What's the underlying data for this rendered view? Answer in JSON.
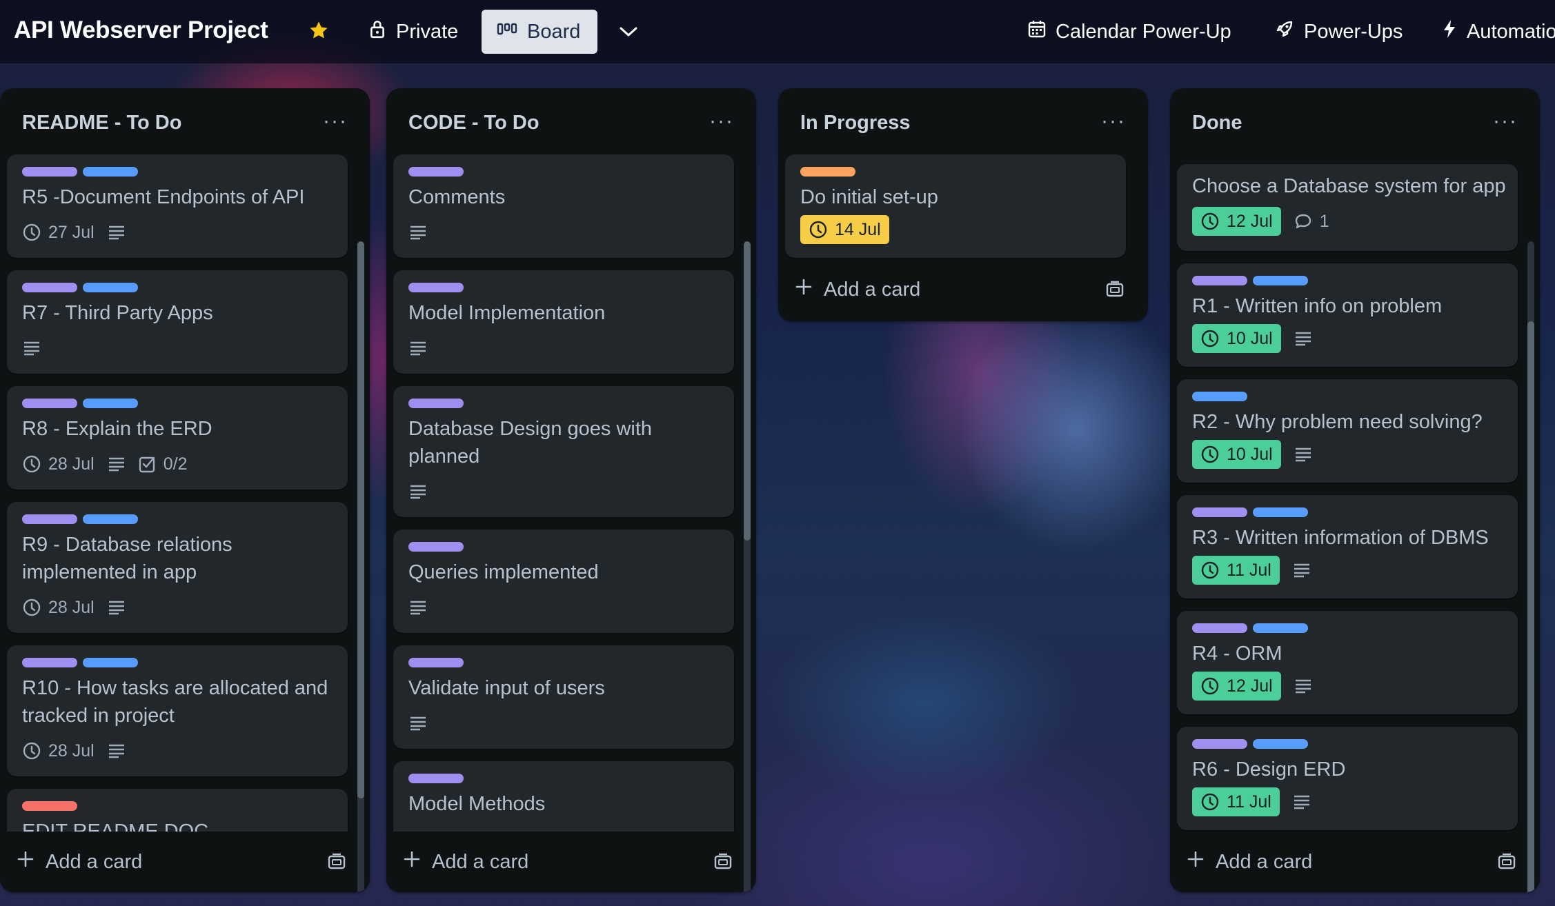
{
  "header": {
    "title": "API Webserver Project",
    "private_label": "Private",
    "board_label": "Board",
    "calendar_label": "Calendar Power-Up",
    "powerups_label": "Power-Ups",
    "automation_label": "Automation",
    "star_color": "#f5c518"
  },
  "common": {
    "add_card": "Add a card",
    "list_menu": "···"
  },
  "lists": [
    {
      "title": "README - To Do",
      "cards": [
        {
          "labels": [
            "purple",
            "blue"
          ],
          "title": "R5 -Document Endpoints of API",
          "due": "27 Jul",
          "description": true
        },
        {
          "labels": [
            "purple",
            "blue"
          ],
          "title": "R7 - Third Party Apps",
          "description": true
        },
        {
          "labels": [
            "purple",
            "blue"
          ],
          "title": "R8 - Explain the ERD",
          "due": "28 Jul",
          "description": true,
          "checklist": "0/2"
        },
        {
          "labels": [
            "purple",
            "blue"
          ],
          "title": "R9 - Database relations implemented in app",
          "due": "28 Jul",
          "description": true
        },
        {
          "labels": [
            "purple",
            "blue"
          ],
          "title": "R10 - How tasks are allocated and tracked in project",
          "due": "28 Jul",
          "description": true
        },
        {
          "labels": [
            "red"
          ],
          "title": "EDIT README DOC"
        }
      ]
    },
    {
      "title": "CODE - To Do",
      "cards": [
        {
          "labels": [
            "purple"
          ],
          "title": "Comments",
          "description": true
        },
        {
          "labels": [
            "purple"
          ],
          "title": "Model Implementation",
          "description": true
        },
        {
          "labels": [
            "purple"
          ],
          "title": "Database Design goes with planned",
          "description": true
        },
        {
          "labels": [
            "purple"
          ],
          "title": "Queries implemented",
          "description": true
        },
        {
          "labels": [
            "purple"
          ],
          "title": "Validate input of users",
          "description": true
        },
        {
          "labels": [
            "purple"
          ],
          "title": "Model Methods"
        }
      ]
    },
    {
      "title": "In Progress",
      "cards": [
        {
          "labels": [
            "orange"
          ],
          "title": "Do initial set-up",
          "due": "14 Jul",
          "due_status": "due-soon"
        }
      ]
    },
    {
      "title": "Done",
      "cards": [
        {
          "labels": [],
          "title": "Choose a Database system for app",
          "due": "12 Jul",
          "due_status": "complete",
          "comments": "1"
        },
        {
          "labels": [
            "purple",
            "blue"
          ],
          "title": "R1 - Written info on problem",
          "due": "10 Jul",
          "due_status": "complete",
          "description": true
        },
        {
          "labels": [
            "blue"
          ],
          "title": "R2 - Why problem need solving?",
          "due": "10 Jul",
          "due_status": "complete",
          "description": true
        },
        {
          "labels": [
            "purple",
            "blue"
          ],
          "title": "R3 - Written information of DBMS",
          "due": "11 Jul",
          "due_status": "complete",
          "description": true
        },
        {
          "labels": [
            "purple",
            "blue"
          ],
          "title": "R4 - ORM",
          "due": "12 Jul",
          "due_status": "complete",
          "description": true
        },
        {
          "labels": [
            "purple",
            "blue"
          ],
          "title": "R6 - Design ERD",
          "due": "11 Jul",
          "due_status": "complete",
          "description": true
        }
      ]
    }
  ],
  "colors": {
    "label_purple": "#9f8fef",
    "label_blue": "#579dff",
    "label_orange": "#fea362",
    "label_red": "#f87168",
    "due_complete": "#4bce97",
    "due_soon": "#f5cd47"
  }
}
